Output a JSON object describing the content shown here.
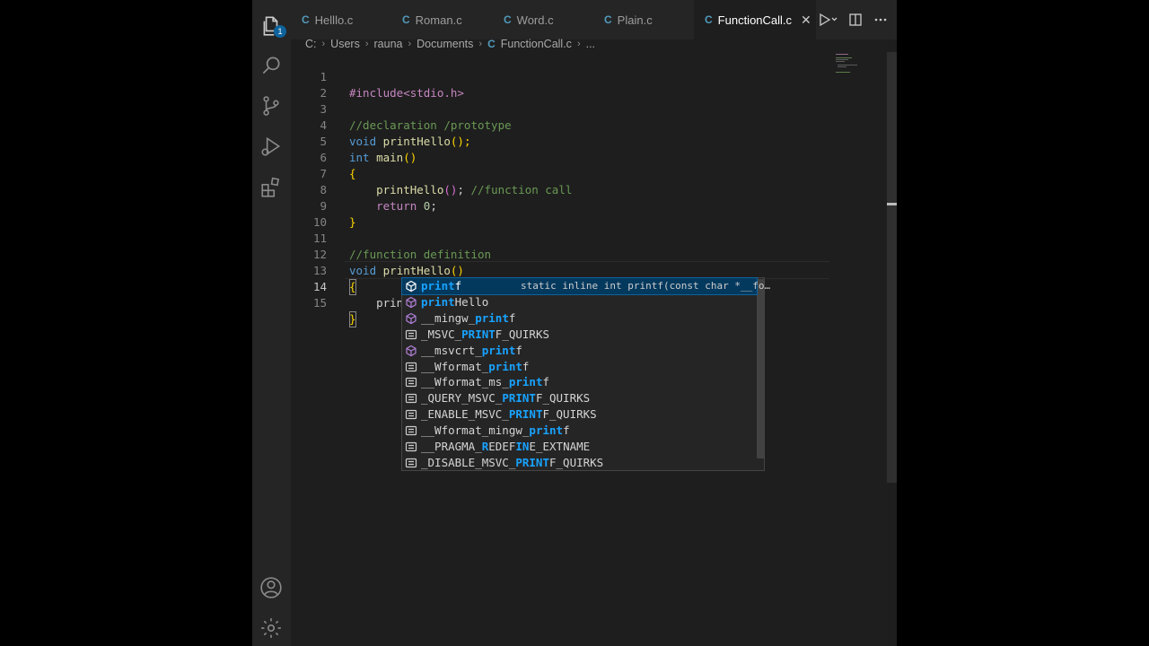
{
  "tabs": [
    {
      "label": "Helllo.c",
      "icon": "c-file-icon",
      "active": false
    },
    {
      "label": "Roman.c",
      "icon": "c-file-icon",
      "active": false
    },
    {
      "label": "Word.c",
      "icon": "c-file-icon",
      "active": false
    },
    {
      "label": "Plain.c",
      "icon": "c-file-icon",
      "active": false
    },
    {
      "label": "FunctionCall.c",
      "icon": "c-file-icon",
      "active": true
    }
  ],
  "tab_icon_letter": "C",
  "tab_close_glyph": "✕",
  "breadcrumb": {
    "parts": [
      "C:",
      "Users",
      "rauna",
      "Documents"
    ],
    "file": "FunctionCall.c",
    "trail": "..."
  },
  "activity": {
    "explorer_badge": "1"
  },
  "editor": {
    "line_numbers": [
      "1",
      "2",
      "3",
      "4",
      "5",
      "6",
      "7",
      "8",
      "9",
      "10",
      "11",
      "12",
      "13",
      "14",
      "15"
    ],
    "current_line": "14",
    "lines": {
      "l1": "#include<stdio.h>",
      "l3": "//declaration /prototype",
      "l4_kw": "void",
      "l4_fn": "printHello",
      "l4_rest": "();",
      "l5_kw": "int",
      "l5_fn": "main",
      "l5_rest": "()",
      "l6": "{",
      "l7_fn": "printHello",
      "l7_paren": "()",
      "l7_semi": ";",
      "l7_cm": "//function call",
      "l8_kw": "return",
      "l8_num": "0",
      "l8_semi": ";",
      "l9": "}",
      "l11": "//function definition",
      "l12_kw": "void",
      "l12_fn": "printHello",
      "l12_rest": "()",
      "l13": "{",
      "l14_typed": "prin",
      "l15": "}"
    }
  },
  "suggestions": {
    "detail": "static inline int printf(const char *__fo…",
    "items": [
      {
        "pre": "",
        "hl": "print",
        "post": "f",
        "kind": "function-icon"
      },
      {
        "pre": "",
        "hl": "print",
        "post": "Hello",
        "kind": "function-icon"
      },
      {
        "pre": "__mingw_",
        "hl": "print",
        "post": "f",
        "kind": "function-icon"
      },
      {
        "pre": "_MSVC_",
        "hl": "PRINT",
        "post": "F_QUIRKS",
        "kind": "macro-icon"
      },
      {
        "pre": "__msvcrt_",
        "hl": "print",
        "post": "f",
        "kind": "function-icon"
      },
      {
        "pre": "__Wformat_",
        "hl": "print",
        "post": "f",
        "kind": "macro-icon"
      },
      {
        "pre": "__Wformat_ms_",
        "hl": "print",
        "post": "f",
        "kind": "macro-icon"
      },
      {
        "pre": "_QUERY_MSVC_",
        "hl": "PRINT",
        "post": "F_QUIRKS",
        "kind": "macro-icon"
      },
      {
        "pre": "_ENABLE_MSVC_",
        "hl": "PRINT",
        "post": "F_QUIRKS",
        "kind": "macro-icon"
      },
      {
        "pre": "__Wformat_mingw_",
        "hl": "print",
        "post": "f",
        "kind": "macro-icon"
      },
      {
        "pre": "__PRAGMA_",
        "hl": "R",
        "post": "EDEF",
        "post_hl": "IN",
        "post2": "E_EXTNAME",
        "kind": "macro-icon"
      },
      {
        "pre": "_DISABLE_MSVC_",
        "hl": "PRINT",
        "post": "F_QUIRKS",
        "kind": "macro-icon"
      }
    ]
  },
  "colors": {
    "editor_bg": "#1e1e1e",
    "accent": "#0e639c",
    "match_highlight": "#18a3ff"
  }
}
